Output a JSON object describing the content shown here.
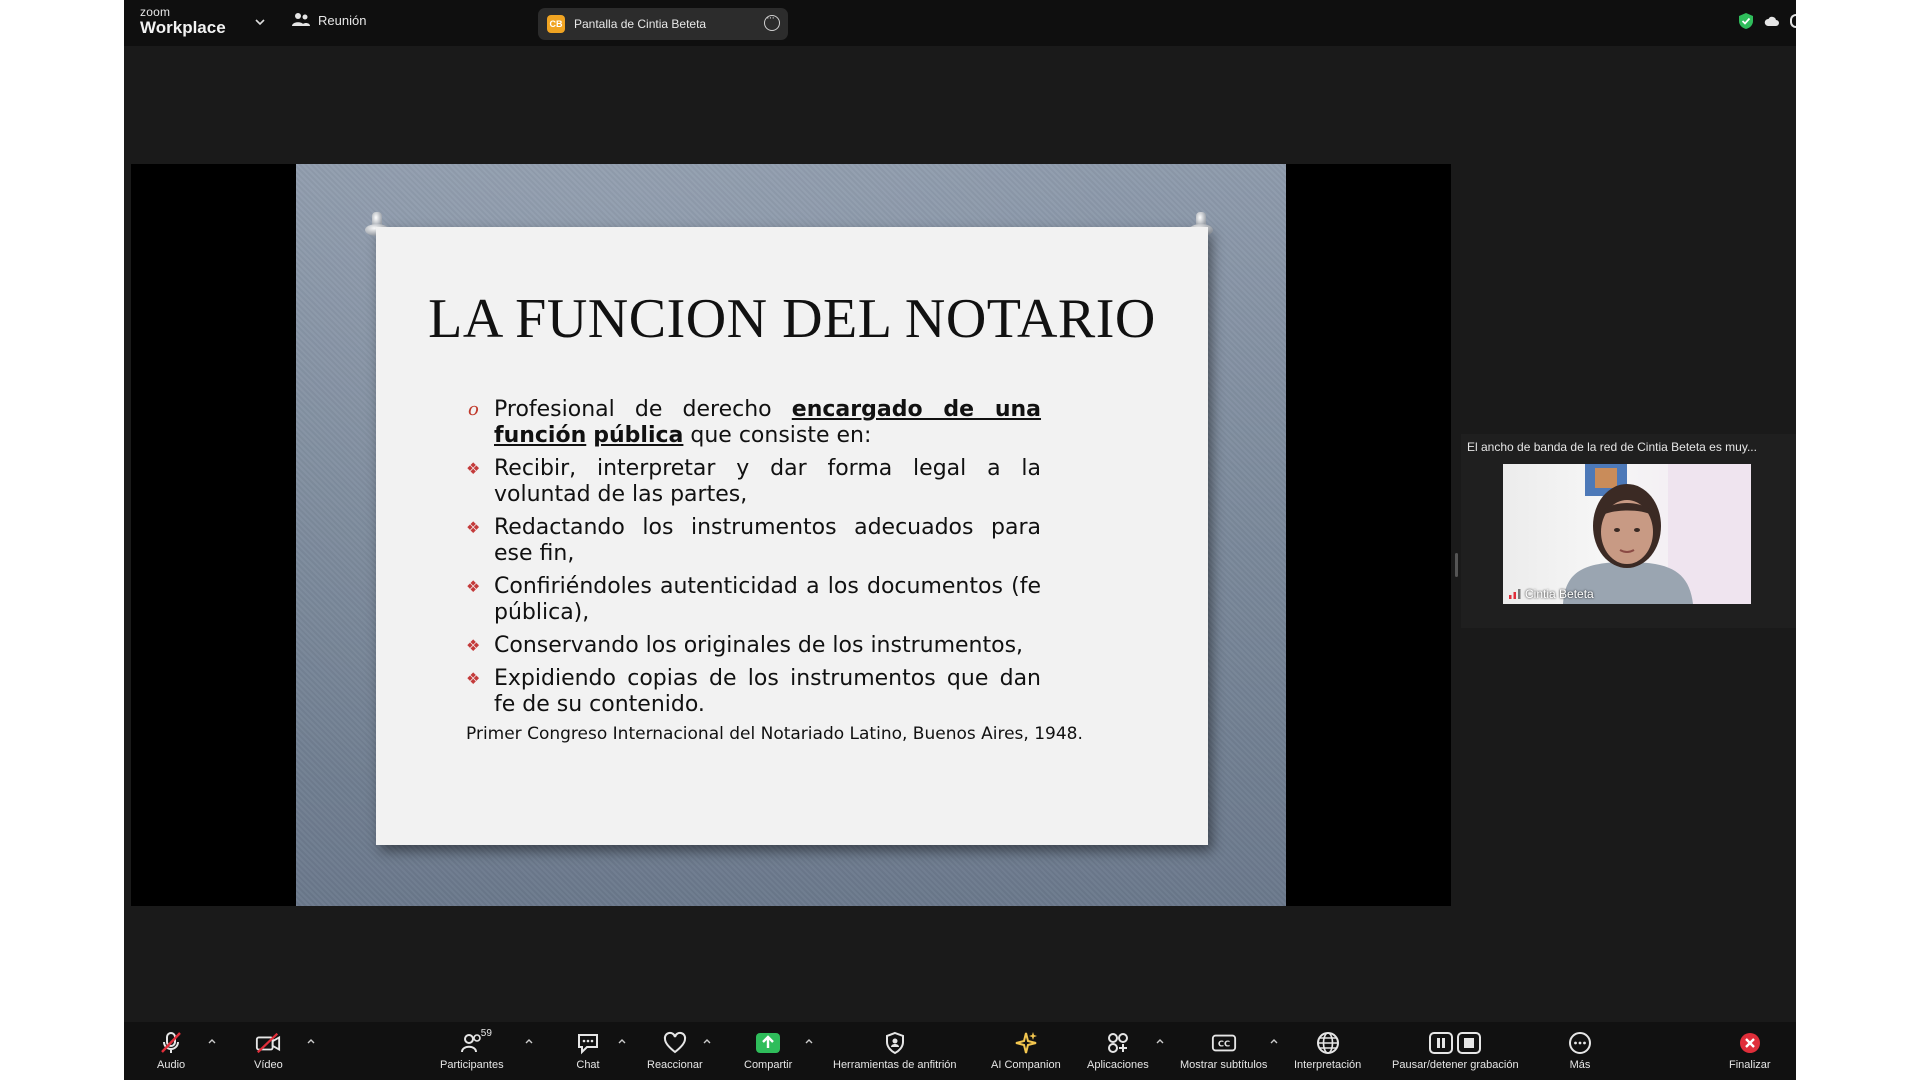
{
  "topbar": {
    "brand_small": "zoom",
    "brand_large": "Workplace",
    "meeting_label": "Reunión",
    "share_initials": "CB",
    "share_label": "Pantalla de Cintia Beteta"
  },
  "slide": {
    "title": "LA FUNCION DEL NOTARIO",
    "b1_part1": "Profesional de derecho ",
    "b1_underline1": "encargado de una función",
    "b1_underline2": "pública",
    "b1_part2": " que consiste en:",
    "bullets": [
      "Recibir, interpretar y dar forma legal a la voluntad de las partes,",
      "Redactando los instrumentos adecuados para ese fin,",
      "Confiriéndoles autenticidad a los documentos (fe pública),",
      "Conservando los originales de los instrumentos,",
      "Expidiendo copias de los instrumentos que dan fe de su contenido."
    ],
    "citation": "Primer Congreso Internacional del Notariado Latino, Buenos Aires, 1948."
  },
  "participant": {
    "caption": "El ancho de banda de la red de Cintia Beteta es muy...",
    "name": "Cintia Beteta"
  },
  "toolbar": {
    "audio": "Audio",
    "video": "Vídeo",
    "participants": "Participantes",
    "participants_count": "59",
    "chat": "Chat",
    "react": "Reaccionar",
    "share": "Compartir",
    "host_tools": "Herramientas de anfitrión",
    "ai_companion": "AI Companion",
    "apps": "Aplicaciones",
    "captions": "Mostrar subtítulos",
    "interpretation": "Interpretación",
    "recording": "Pausar/detener grabación",
    "more": "Más",
    "end": "Finalizar"
  },
  "colors": {
    "share_green": "#2fbd5b",
    "end_red": "#e02e3a",
    "accent_orange": "#f0a422",
    "ai_yellow": "#f3c64f"
  },
  "icons": [
    "chevron-down-icon",
    "people-icon",
    "more-icon",
    "shield-check-icon",
    "cloud-icon",
    "mic-off-icon",
    "video-off-icon",
    "participants-icon",
    "chat-icon",
    "heart-icon",
    "share-arrow-icon",
    "shield-icon",
    "sparkle-icon",
    "apps-icon",
    "cc-icon",
    "globe-icon",
    "pause-icon",
    "stop-icon",
    "ellipsis-icon",
    "close-circle-icon"
  ]
}
